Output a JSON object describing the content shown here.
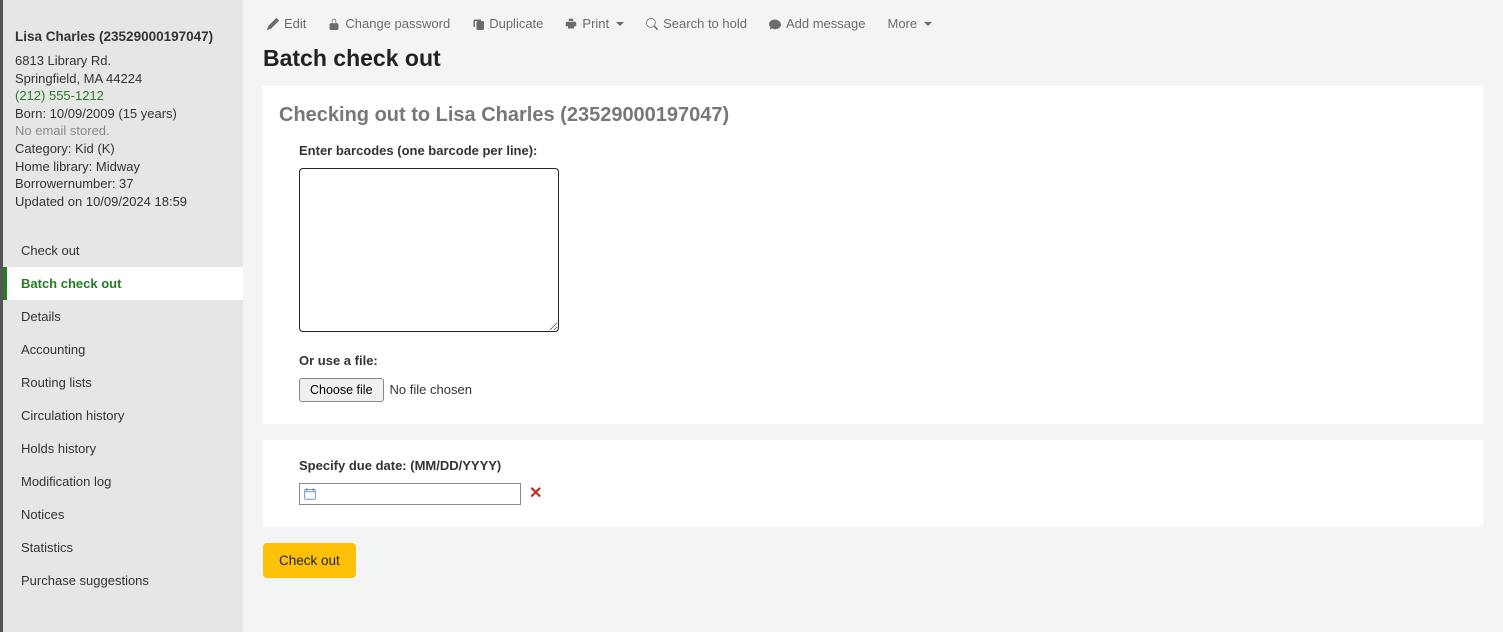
{
  "patron": {
    "name": "Lisa Charles (23529000197047)",
    "address1": "6813 Library Rd.",
    "address2": "Springfield, MA 44224",
    "phone": "(212) 555-1212",
    "born": "Born: 10/09/2009 (15 years)",
    "no_email": "No email stored.",
    "category": "Category: Kid (K)",
    "home_library": "Home library: Midway",
    "borrowernumber": "Borrowernumber: 37",
    "updated": "Updated on 10/09/2024 18:59"
  },
  "sidenav": {
    "items": [
      {
        "label": "Check out"
      },
      {
        "label": "Batch check out"
      },
      {
        "label": "Details"
      },
      {
        "label": "Accounting"
      },
      {
        "label": "Routing lists"
      },
      {
        "label": "Circulation history"
      },
      {
        "label": "Holds history"
      },
      {
        "label": "Modification log"
      },
      {
        "label": "Notices"
      },
      {
        "label": "Statistics"
      },
      {
        "label": "Purchase suggestions"
      }
    ],
    "active_index": 1
  },
  "toolbar": {
    "edit": "Edit",
    "change_password": "Change password",
    "duplicate": "Duplicate",
    "print": "Print",
    "search_to_hold": "Search to hold",
    "add_message": "Add message",
    "more": "More"
  },
  "page": {
    "title": "Batch check out",
    "section_title": "Checking out to Lisa Charles (23529000197047)",
    "barcodes_label": "Enter barcodes (one barcode per line):",
    "or_use_file_label": "Or use a file:",
    "choose_file_btn": "Choose file",
    "file_status": "No file chosen",
    "due_date_label": "Specify due date: (MM/DD/YYYY)",
    "checkout_btn": "Check out"
  }
}
